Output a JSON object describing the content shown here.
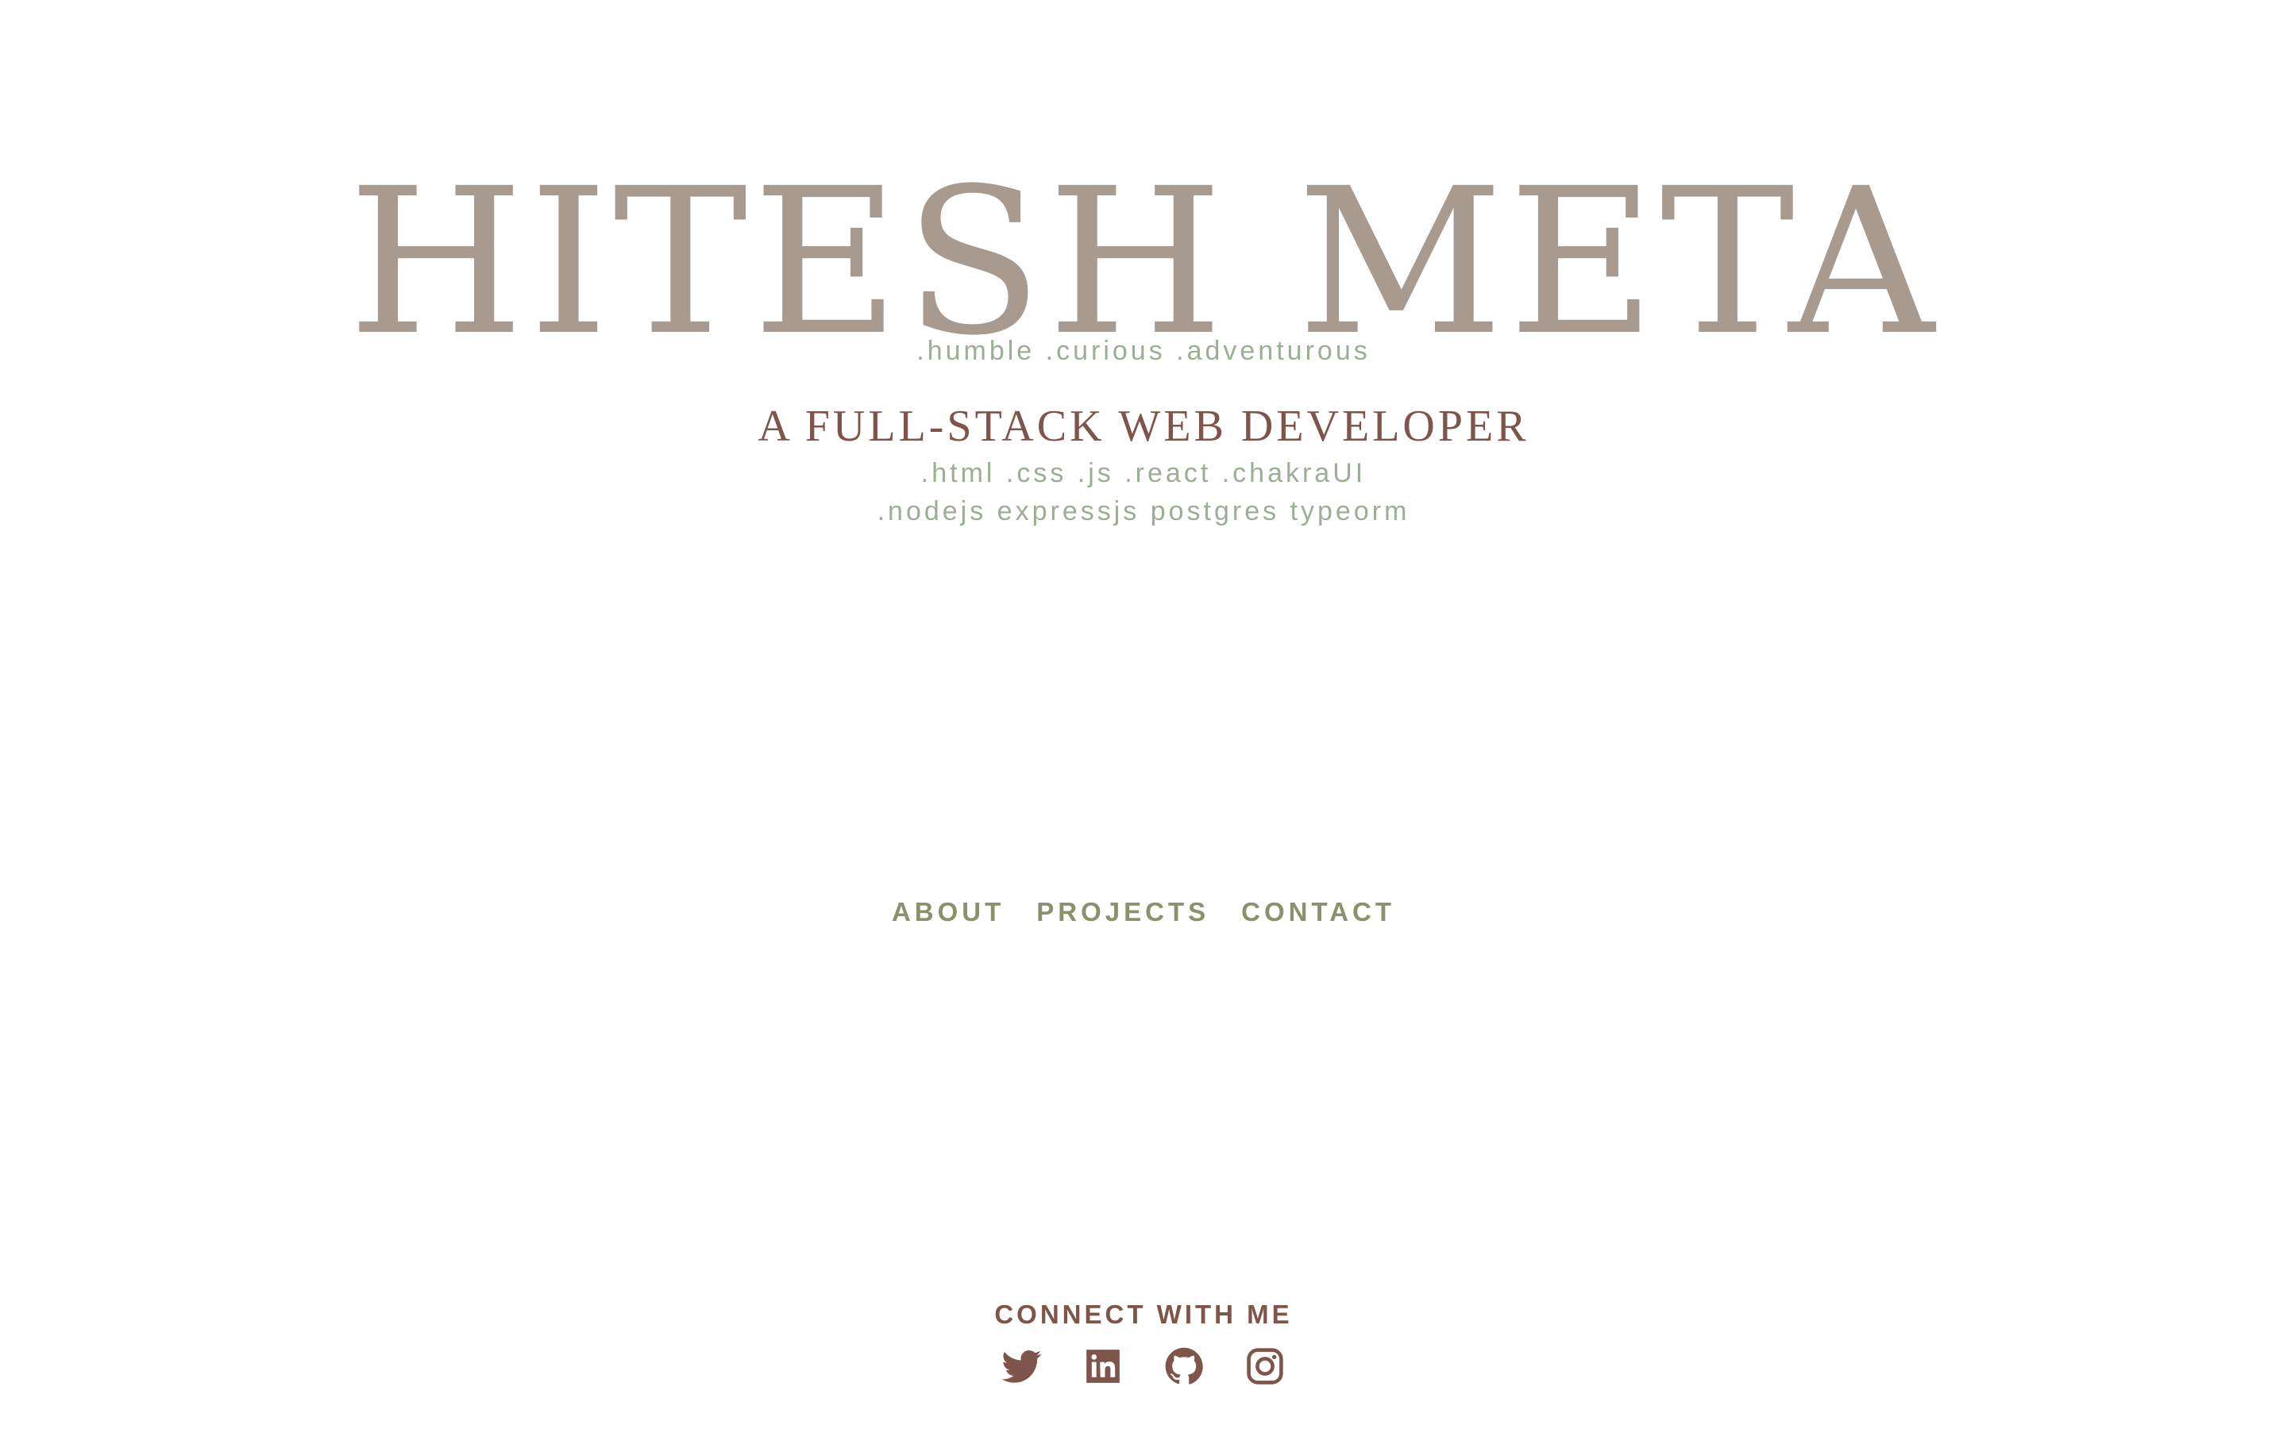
{
  "hero": {
    "name": "HITESH META",
    "traits": ".humble .curious .adventurous",
    "role": "A FULL-STACK WEB DEVELOPER",
    "stack_line_1": ".html .css .js .react .chakraUI",
    "stack_line_2": ".nodejs expressjs postgres typeorm"
  },
  "nav": {
    "items": [
      {
        "label": "ABOUT"
      },
      {
        "label": "PROJECTS"
      },
      {
        "label": "CONTACT"
      }
    ]
  },
  "footer": {
    "connect_label": "CONNECT WITH ME",
    "socials": [
      {
        "icon": "twitter-icon"
      },
      {
        "icon": "linkedin-icon"
      },
      {
        "icon": "github-icon"
      },
      {
        "icon": "instagram-icon"
      }
    ]
  },
  "colors": {
    "name": "#a89a8f",
    "accent_brown": "#7f544a",
    "sage_text": "#9aaf94",
    "nav_olive": "#8a916b"
  }
}
